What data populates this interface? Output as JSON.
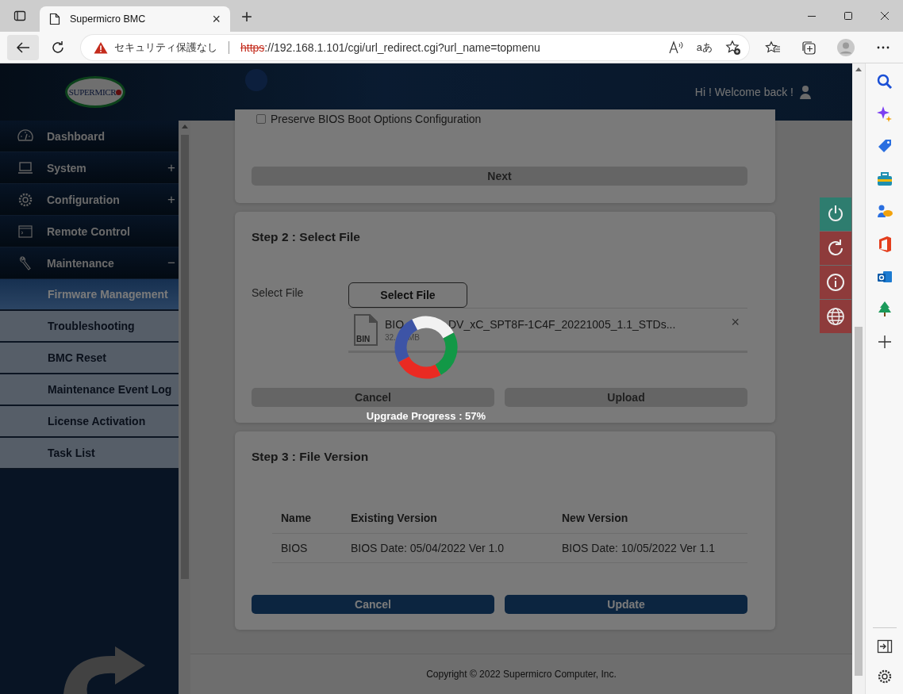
{
  "browser": {
    "tab_title": "Supermicro BMC",
    "tab_close": "×",
    "new_tab": "+",
    "security_label": "セキュリティ保護なし",
    "url_scheme": "https",
    "url_rest": "://192.168.1.101/cgi/url_redirect.cgi?url_name=topmenu",
    "translate_label": "aあ"
  },
  "header": {
    "logo_text": "SUPERMICR",
    "welcome": "Hi ! Welcome back !"
  },
  "sidebar": {
    "items": [
      {
        "label": "Dashboard"
      },
      {
        "label": "System",
        "toggle": "+"
      },
      {
        "label": "Configuration",
        "toggle": "+"
      },
      {
        "label": "Remote Control"
      },
      {
        "label": "Maintenance",
        "toggle": "−",
        "children": [
          {
            "label": "Firmware Management",
            "selected": true
          },
          {
            "label": "Troubleshooting",
            "selected": false
          },
          {
            "label": "BMC Reset",
            "selected": false
          },
          {
            "label": "Maintenance Event Log",
            "selected": false
          },
          {
            "label": "License Activation",
            "selected": false
          },
          {
            "label": "Task List",
            "selected": false
          }
        ]
      }
    ]
  },
  "step1": {
    "option": "Preserve BIOS Boot Options Configuration",
    "checked": false,
    "next": {
      "label": "Next",
      "disabled": true
    }
  },
  "step2": {
    "title": "Step 2 : Select File",
    "field_label": "Select File",
    "select_button": "Select File",
    "file": {
      "type_label": "BIN",
      "name_start": "BIO",
      "name_end": "DV_xC_SPT8F-1C4F_20221005_1.1_STDs...",
      "size_start": "32.",
      "size_end": "MB",
      "remove": "×"
    },
    "buttons": [
      {
        "label": "Cancel",
        "disabled": true
      },
      {
        "label": "Upload",
        "disabled": true
      }
    ]
  },
  "step3": {
    "title": "Step 3 : File Version",
    "table": {
      "columns": [
        "Name",
        "Existing Version",
        "New Version"
      ],
      "rows": [
        [
          "BIOS",
          "BIOS Date: 05/04/2022 Ver 1.0",
          "BIOS Date: 10/05/2022 Ver 1.1"
        ]
      ]
    },
    "buttons": [
      {
        "label": "Cancel",
        "disabled": false
      },
      {
        "label": "Update",
        "disabled": false
      }
    ]
  },
  "footer": {
    "copyright": "Copyright © 2022 Supermicro Computer, Inc."
  },
  "quick_actions": [
    {
      "kind": "power",
      "color": "#2e7d6f"
    },
    {
      "kind": "reset",
      "color": "#8e3b3b"
    },
    {
      "kind": "info",
      "color": "#8e3b3b"
    },
    {
      "kind": "language",
      "color": "#8e3b3b"
    }
  ],
  "overlay": {
    "progress_text": "Upgrade Progress : 57%"
  }
}
